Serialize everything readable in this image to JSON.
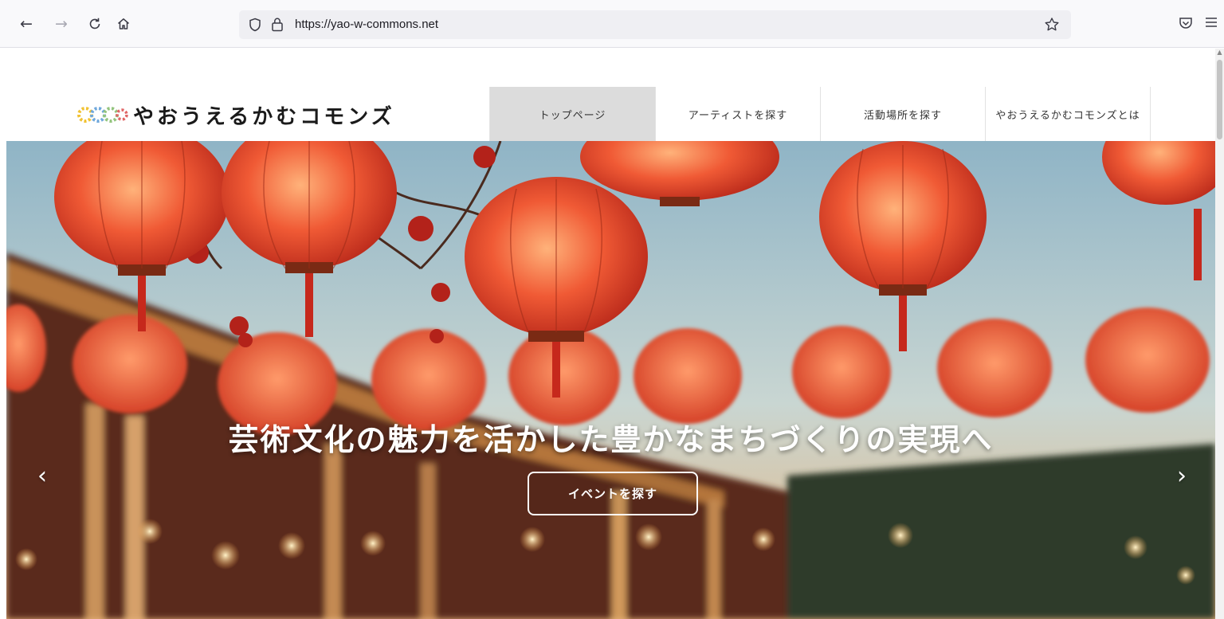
{
  "browser": {
    "url": "https://yao-w-commons.net",
    "icons": [
      "back-icon",
      "forward-icon",
      "reload-icon",
      "home-icon",
      "shield-icon",
      "lock-icon",
      "bookmark-star-icon",
      "pocket-icon",
      "menu-icon"
    ]
  },
  "site": {
    "logo_text": "やおうえるかむコモンズ",
    "nav": [
      {
        "label": "トップページ",
        "active": true
      },
      {
        "label": "アーティストを探す",
        "active": false
      },
      {
        "label": "活動場所を探す",
        "active": false
      },
      {
        "label": "やおうえるかむコモンズとは",
        "active": false
      }
    ]
  },
  "hero": {
    "title": "芸術文化の魅力を活かした豊かなまちづくりの実現へ",
    "cta_label": "イベントを探す",
    "prev_label": "‹",
    "next_label": "›"
  },
  "colors": {
    "lantern": "#e8442a",
    "sky": "#b9d3dc",
    "accent_dots": [
      "#f1c232",
      "#6fa8dc",
      "#93c47d",
      "#e06666",
      "#8e7cc3",
      "#f6b26b"
    ]
  }
}
